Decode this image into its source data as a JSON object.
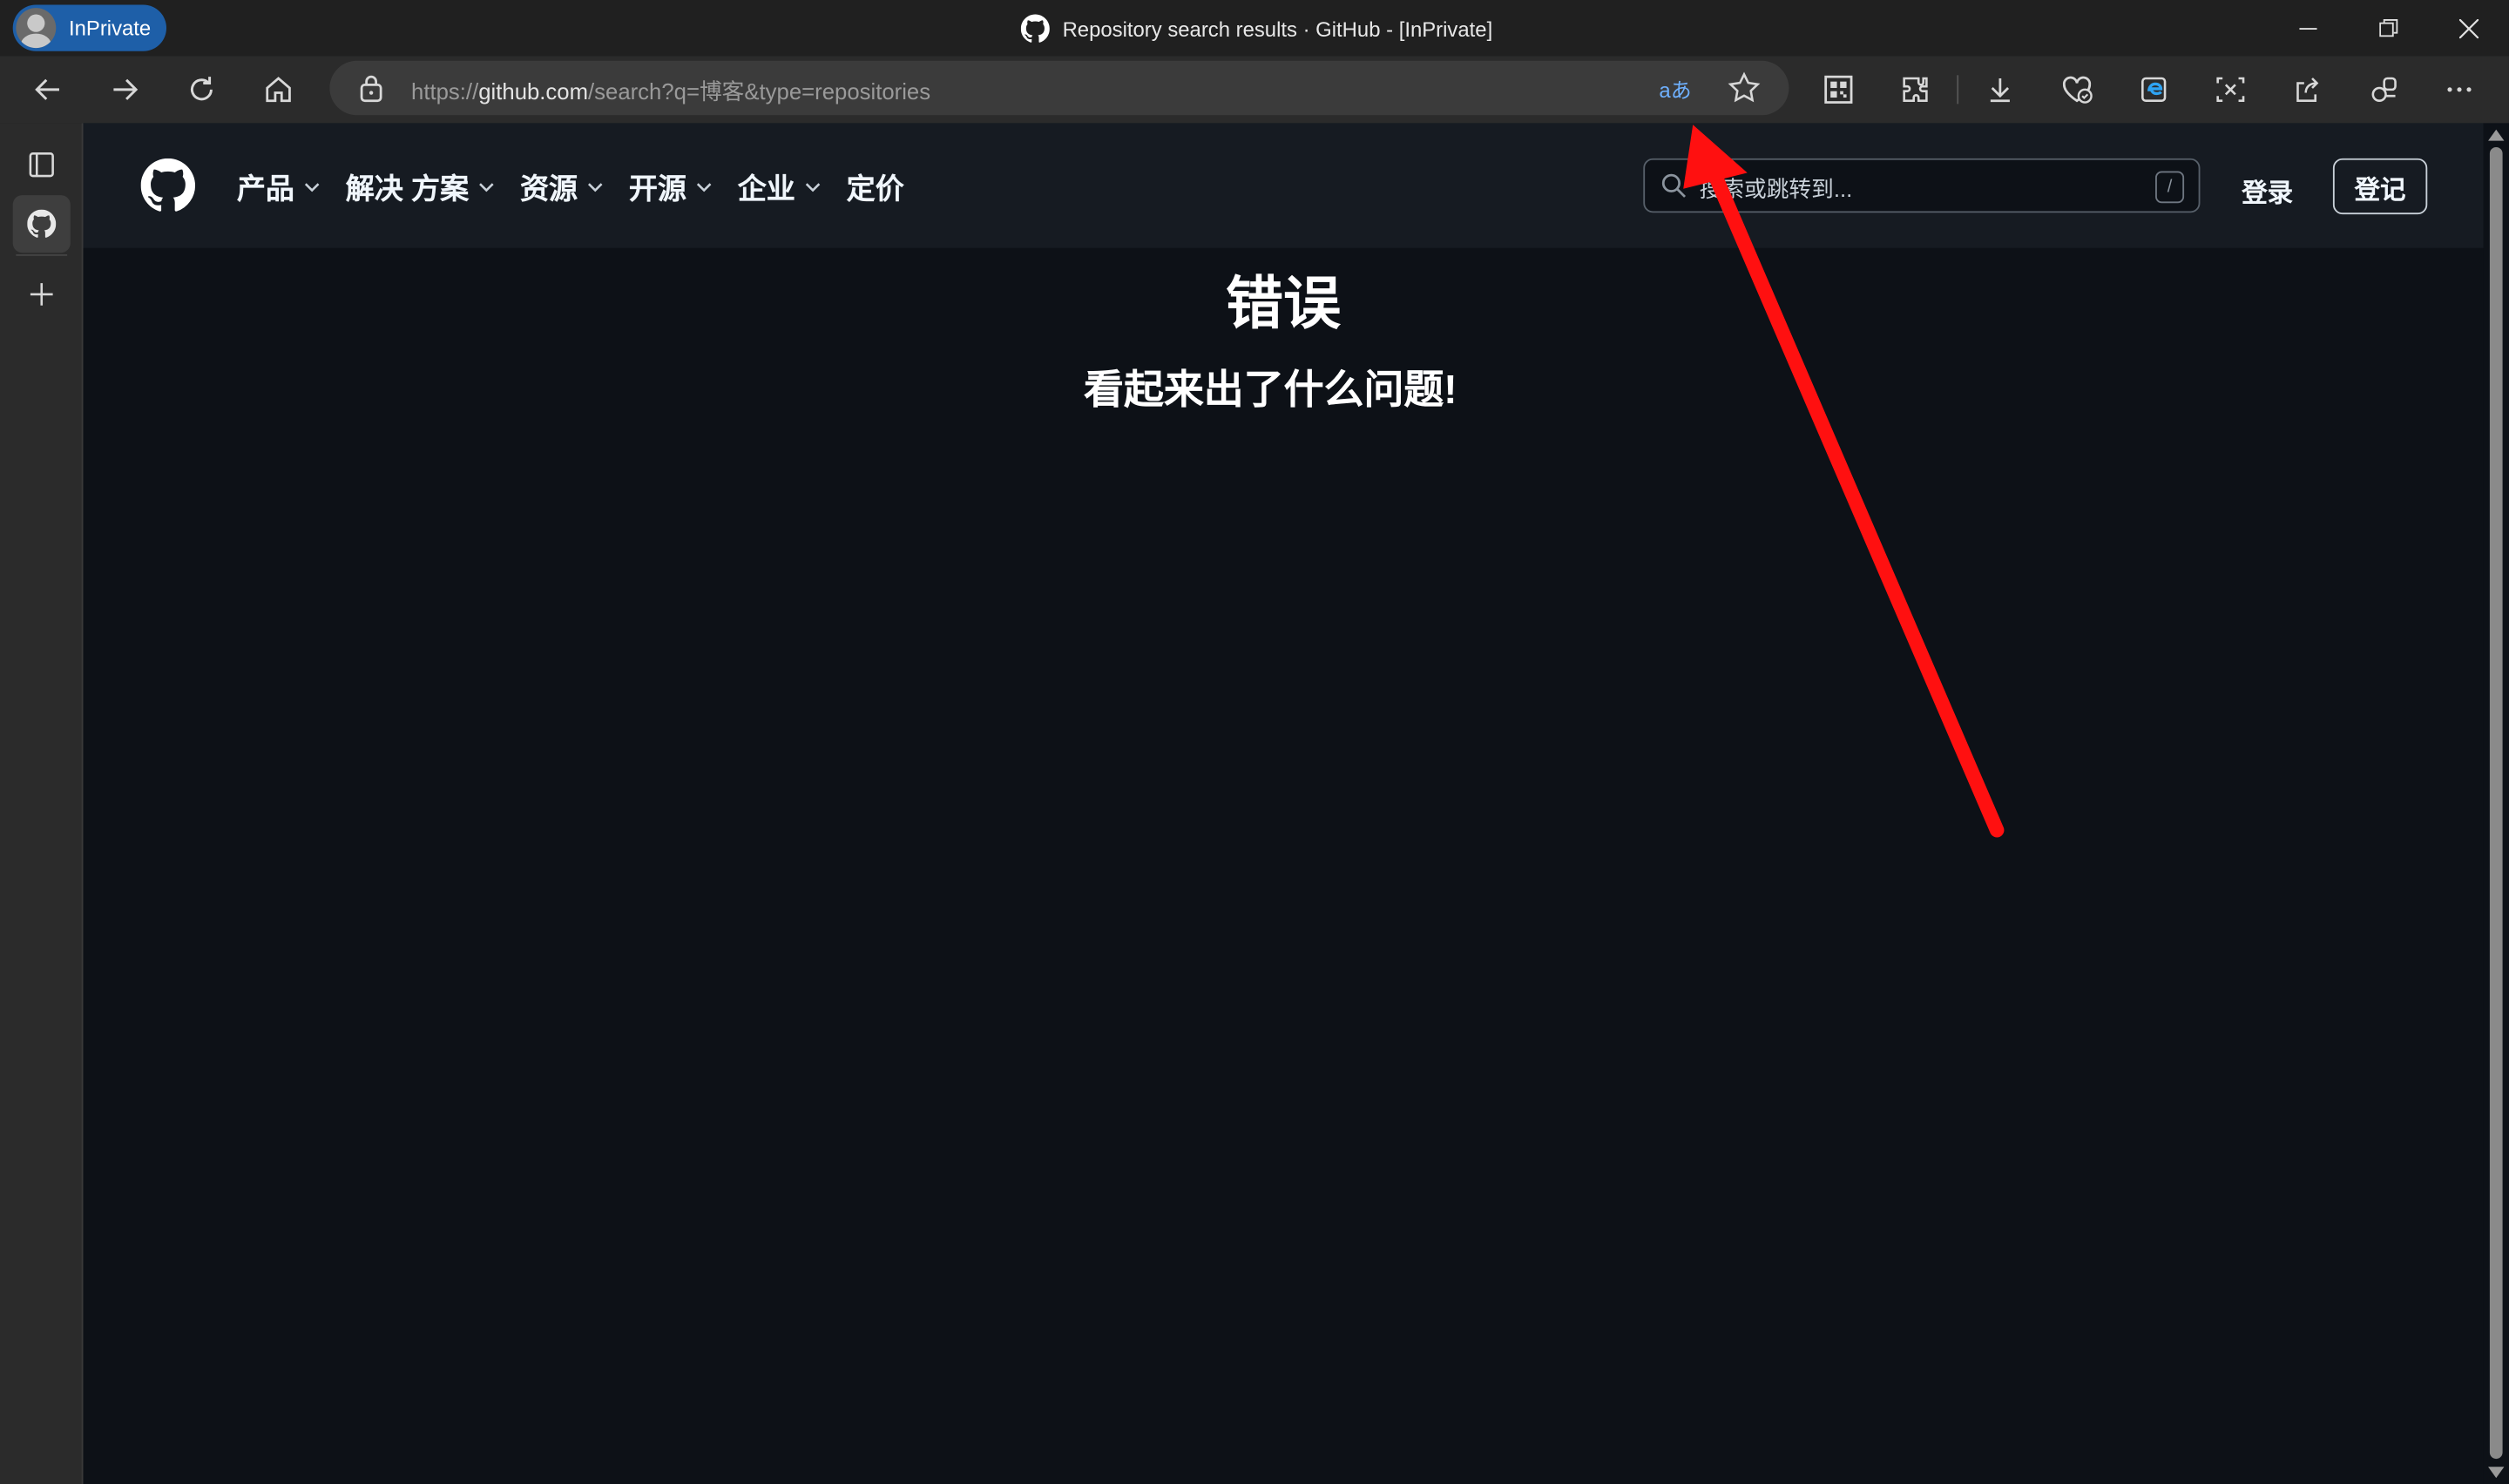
{
  "browser": {
    "profile_label": "InPrivate",
    "window_title": "Repository search results · GitHub - [InPrivate]",
    "address": {
      "scheme_prefix": "https://",
      "host": "github.com",
      "path": "/search?q=博客&type=repositories",
      "translate_glyph": "aあ"
    },
    "toolbar_icons": [
      "back-icon",
      "forward-icon",
      "refresh-icon",
      "home-icon",
      "lock-icon",
      "translate-icon",
      "favorite-star-icon",
      "qr-code-icon",
      "extensions-icon",
      "downloads-icon",
      "browser-essentials-icon",
      "edge-collections-icon",
      "screenshot-icon",
      "share-icon",
      "copilot-icon",
      "more-icon"
    ],
    "window_controls": [
      "minimize-icon",
      "restore-icon",
      "close-icon"
    ],
    "sidebar_icons": [
      "tab-actions-icon",
      "github-tab-icon",
      "new-tab-icon"
    ]
  },
  "github": {
    "nav": [
      {
        "label": "产品",
        "has_menu": true
      },
      {
        "label": "解决 方案",
        "has_menu": true
      },
      {
        "label": "资源",
        "has_menu": true
      },
      {
        "label": "开源",
        "has_menu": true
      },
      {
        "label": "企业",
        "has_menu": true
      },
      {
        "label": "定价",
        "has_menu": false
      }
    ],
    "search_placeholder": "搜索或跳转到...",
    "search_shortcut": "/",
    "sign_in": "登录",
    "sign_up": "登记"
  },
  "error": {
    "title": "错误",
    "subtitle": "看起来出了什么问题!"
  },
  "colors": {
    "page_bg": "#0d1117",
    "header_bg": "#161b22",
    "annotation_arrow": "#ff1010",
    "inprivate_pill": "#1e5fa8"
  }
}
